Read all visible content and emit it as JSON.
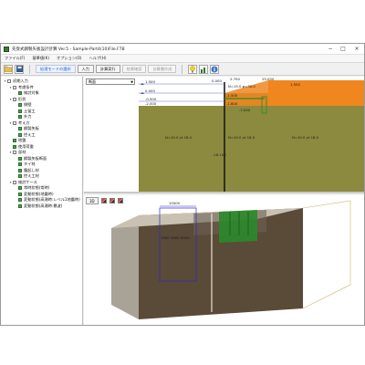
{
  "window": {
    "title": "先受式鋼製矢板設計計算 Ver.5 - Sample-Part4(10)File.F7B",
    "minimize": "−",
    "maximize": "□",
    "close": "×"
  },
  "menu": [
    "ファイル(F)",
    "基準値(K)",
    "オプション(O)",
    "ヘルプ(H)"
  ],
  "toolbar": {
    "mode_select": "処理モードの選択",
    "input": "入力",
    "calc": "計算実行",
    "result_check": "結果確認",
    "calc_doc": "計算書作成"
  },
  "tree": [
    {
      "label": "初期入力",
      "level": 0,
      "open": true
    },
    {
      "label": "考慮条件",
      "level": 1,
      "open": true
    },
    {
      "label": "検討対象",
      "level": 2,
      "open": false
    },
    {
      "label": "形状",
      "level": 1,
      "open": true
    },
    {
      "label": "側壁",
      "level": 2,
      "open": false
    },
    {
      "label": "土留工",
      "level": 2,
      "open": false
    },
    {
      "label": "外力",
      "level": 2,
      "open": false
    },
    {
      "label": "考え方",
      "level": 1,
      "open": true
    },
    {
      "label": "鋼製矢板",
      "level": 2,
      "open": false
    },
    {
      "label": "控え工",
      "level": 2,
      "open": false
    },
    {
      "label": "地盤",
      "level": 1,
      "open": false
    },
    {
      "label": "使用荷重",
      "level": 1,
      "open": false
    },
    {
      "label": "部材",
      "level": 1,
      "open": true
    },
    {
      "label": "鋼製矢板断面",
      "level": 2,
      "open": false
    },
    {
      "label": "タイ材",
      "level": 2,
      "open": false
    },
    {
      "label": "腹起し材",
      "level": 2,
      "open": false
    },
    {
      "label": "控え工材",
      "level": 2,
      "open": false
    },
    {
      "label": "検討ケース",
      "level": 1,
      "open": true
    },
    {
      "label": "常時状態(常時)",
      "level": 2,
      "open": false
    },
    {
      "label": "変動状態(地震時)",
      "level": 2,
      "open": false
    },
    {
      "label": "変動状態(高潮時:レベル1地震時)",
      "level": 2,
      "open": false
    },
    {
      "label": "変動状態(高潮時:暴波)",
      "level": 2,
      "open": false
    }
  ],
  "section_view": {
    "combo_value": "断面",
    "levels": [
      "1.500",
      "0.000",
      "-0.500",
      "-2.000",
      "-16.100"
    ],
    "soil_left": "N=10.0 γt   18.0",
    "soil_mid": "N=10.0 γt   18.0",
    "soil_right": "N=10.0 γt   18.0",
    "bottom_level": "-16.100",
    "top_dims": [
      "2.700",
      "25.000"
    ],
    "fill_label": "N=15.0 φ=30.0",
    "right_level": "1.500",
    "tie_level": "-1.500",
    "right_low": "-7.000",
    "small_labels": [
      "0.000",
      "-1.800"
    ]
  },
  "view3d": {
    "button": "3D",
    "width_label": "10000",
    "left_dim": "1500",
    "mid_dim": "3000",
    "right_dim": "8000"
  },
  "colors": {
    "soil_olive": "#8b8a3e",
    "fill_orange": "#f0861e",
    "tie_green": "#2b8a2b",
    "frame_blue": "#2a2acc"
  }
}
